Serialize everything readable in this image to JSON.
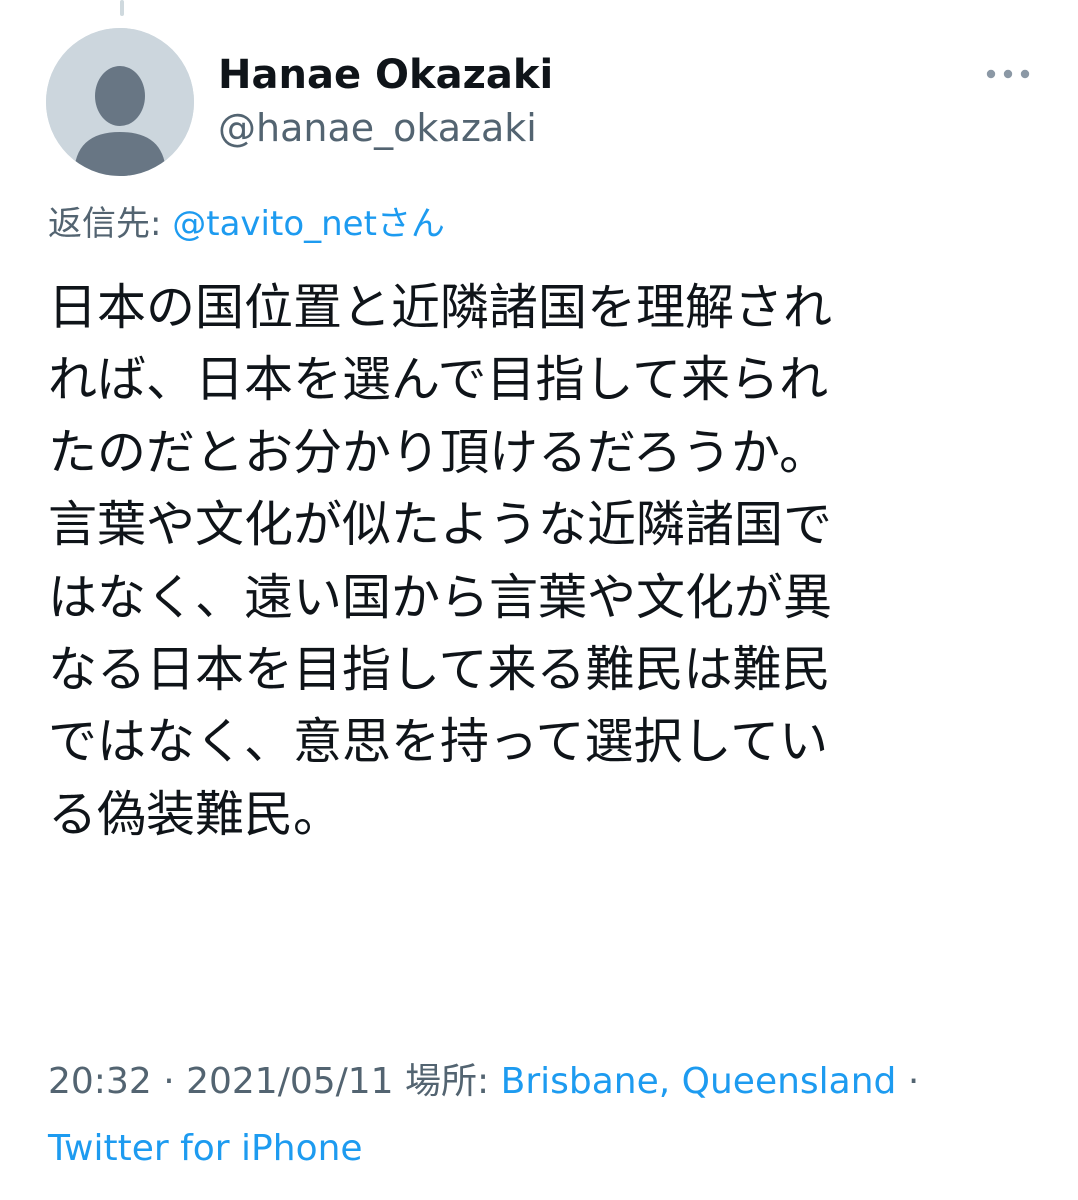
{
  "author": {
    "display_name": "Hanae Okazaki",
    "handle": "@hanae_okazaki",
    "avatar_icon": "default-profile-silhouette"
  },
  "reply": {
    "prefix": "返信先: ",
    "mention": "@tavito_net",
    "suffix": "さん"
  },
  "tweet": {
    "lines": [
      "日本の国位置と近隣諸国を理解され",
      "れば、日本を選んで目指して来られ",
      "たのだとお分かり頂けるだろうか。",
      "言葉や文化が似たような近隣諸国で",
      "はなく、遠い国から言葉や文化が異",
      "なる日本を目指して来る難民は難民",
      "ではなく、意思を持って選択してい",
      "る偽装難民。"
    ]
  },
  "meta": {
    "time": "20:32",
    "separator": " · ",
    "date": "2021/05/11",
    "location_label": " 場所: ",
    "location": "Brisbane, Queensland",
    "trailing_separator": " ·",
    "source": "Twitter for iPhone"
  },
  "colors": {
    "link": "#1d9bf0",
    "secondary_text": "#536471",
    "primary_text": "#0f1419",
    "avatar_bg": "#ccd6dd",
    "avatar_fg": "#687684"
  }
}
